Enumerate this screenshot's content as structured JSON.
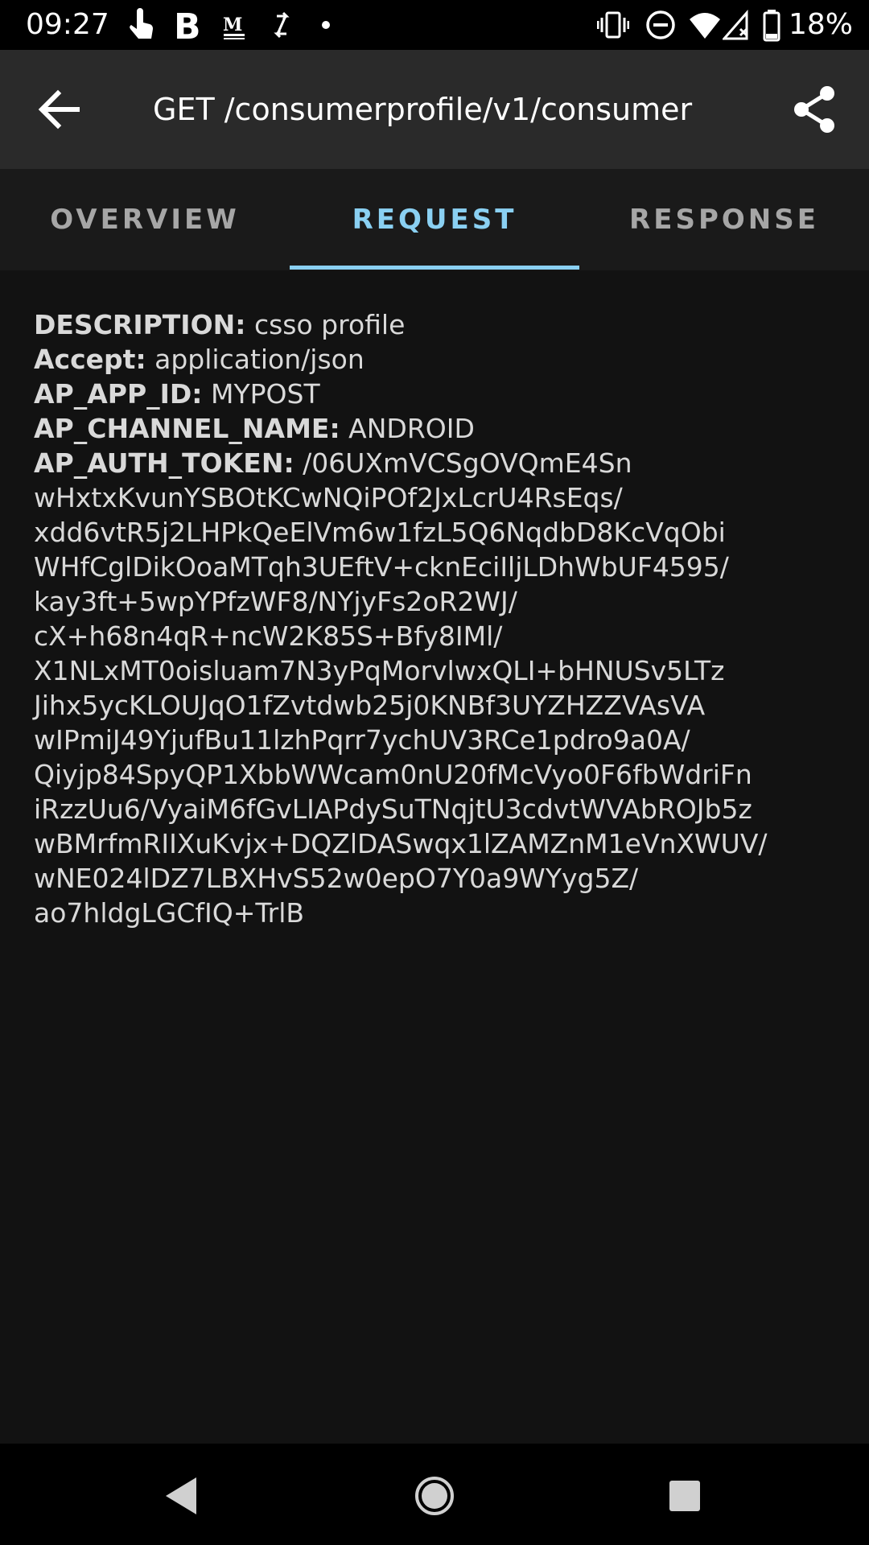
{
  "status_bar": {
    "time": "09:27",
    "battery": "18%",
    "icons": [
      "touch-icon",
      "b-app-icon",
      "gmail-icon",
      "sync-icon",
      "dot-icon",
      "vibrate-icon",
      "dnd-icon",
      "wifi-icon",
      "signal-icon",
      "battery-icon"
    ]
  },
  "app_bar": {
    "title": "GET /consumerprofile/v1/consumer",
    "back_icon": "arrow-back-icon",
    "share_icon": "share-icon"
  },
  "tabs": [
    {
      "label": "OVERVIEW",
      "active": false
    },
    {
      "label": "REQUEST",
      "active": true
    },
    {
      "label": "RESPONSE",
      "active": false
    }
  ],
  "request": {
    "headers": [
      {
        "key": "DESCRIPTION:",
        "value": " csso profile"
      },
      {
        "key": "Accept:",
        "value": " application/json"
      },
      {
        "key": "AP_APP_ID:",
        "value": " MYPOST"
      },
      {
        "key": "AP_CHANNEL_NAME:",
        "value": " ANDROID"
      },
      {
        "key": "AP_AUTH_TOKEN:",
        "value": " /06UXmVCSgOVQmE4Sn"
      }
    ],
    "token_lines": [
      "wHxtxKvunYSBOtKCwNQiPOf2JxLcrU4RsEqs/",
      "xdd6vtR5j2LHPkQeElVm6w1fzL5Q6NqdbD8KcVqObi",
      "WHfCglDikOoaMTqh3UEftV+cknEciIljLDhWbUF4595/",
      "kay3ft+5wpYPfzWF8/NYjyFs2oR2WJ/",
      "cX+h68n4qR+ncW2K85S+Bfy8IMl/",
      "X1NLxMT0oisluam7N3yPqMorvlwxQLI+bHNUSv5LTz",
      "Jihx5ycKLOUJqO1fZvtdwb25j0KNBf3UYZHZZVAsVA",
      "wIPmiJ49YjufBu11lzhPqrr7ychUV3RCe1pdro9a0A/",
      "Qiyjp84SpyQP1XbbWWcam0nU20fMcVyo0F6fbWdriFn",
      "iRzzUu6/VyaiM6fGvLIAPdySuTNqjtU3cdvtWVAbROJb5z",
      "wBMrfmRIIXuKvjx+DQZlDASwqx1lZAMZnM1eVnXWUV/",
      "wNE024lDZ7LBXHvS52w0epO7Y0a9WYyg5Z/",
      "ao7hldgLGCfIQ+TrlB"
    ]
  },
  "nav_bar": {
    "back": "nav-back-icon",
    "home": "nav-home-icon",
    "recents": "nav-recents-icon"
  }
}
